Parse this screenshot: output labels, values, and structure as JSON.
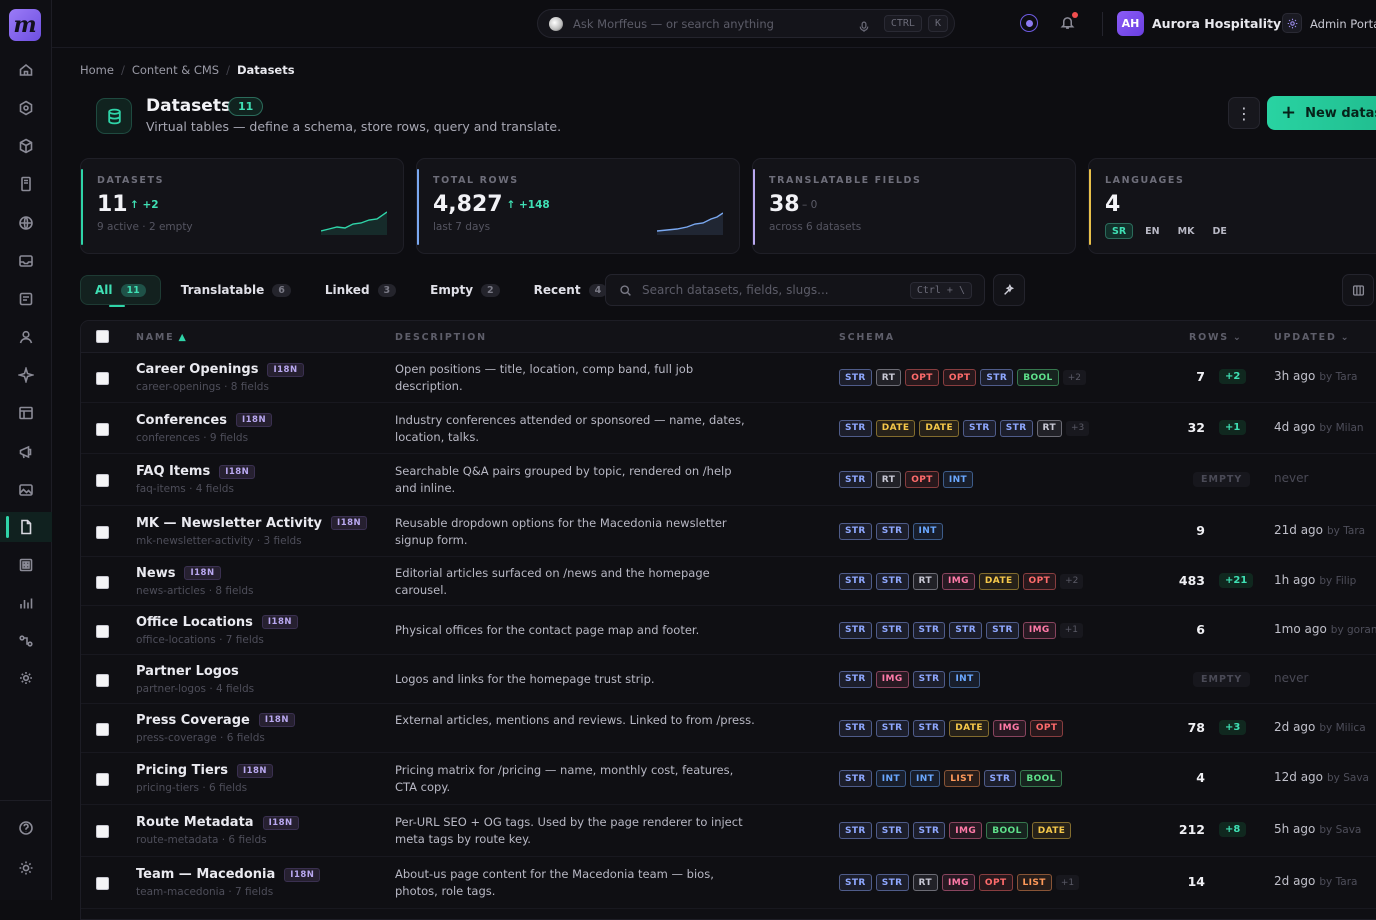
{
  "app": {
    "logo_letter": "m"
  },
  "sidebar": {
    "items": [
      "home-icon",
      "settings-hex-icon",
      "cube-icon",
      "book-icon",
      "globe-icon",
      "inbox-icon",
      "form-icon",
      "user-icon",
      "sparkle-icon",
      "table-icon",
      "megaphone-icon",
      "image-icon",
      "document-icon",
      "grid-icon",
      "bar-chart-icon",
      "flow-icon",
      "cog-icon"
    ],
    "active": "document-icon",
    "bottom": [
      "help-icon",
      "sun-icon"
    ]
  },
  "topbar": {
    "search_placeholder": "Ask Morffeus — or search anything",
    "kbd_ctrl": "CTRL",
    "kbd_k": "K",
    "avatar_initials": "AH",
    "org_name": "Aurora Hospitality",
    "portal_label": "Admin Portal"
  },
  "breadcrumb": {
    "items": [
      "Home",
      "Content & CMS"
    ],
    "current": "Datasets"
  },
  "header": {
    "title": "Datasets",
    "count": "11",
    "subtitle": "Virtual tables — define a schema, store rows, query and translate.",
    "new_button": "New dataset"
  },
  "stats": [
    {
      "label": "DATASETS",
      "value": "11",
      "delta": "+2",
      "sub": "9 active · 2 empty",
      "color": "#2fd4a8"
    },
    {
      "label": "TOTAL ROWS",
      "value": "4,827",
      "delta": "+148",
      "sub": "last 7 days",
      "color": "#7aa8f0"
    },
    {
      "label": "TRANSLATABLE FIELDS",
      "value": "38",
      "delta": "0",
      "sub": "across 6 datasets",
      "color": "#b9a8f0"
    },
    {
      "label": "LANGUAGES",
      "value": "4",
      "langs": [
        "SR",
        "EN",
        "MK",
        "DE"
      ],
      "color": "#e8c04a"
    }
  ],
  "filters": {
    "tabs": [
      {
        "label": "All",
        "count": "11"
      },
      {
        "label": "Translatable",
        "count": "6"
      },
      {
        "label": "Linked",
        "count": "3"
      },
      {
        "label": "Empty",
        "count": "2"
      },
      {
        "label": "Recent",
        "count": "4"
      }
    ],
    "active": "All",
    "search_placeholder": "Search datasets, fields, slugs...",
    "search_kbd": "Ctrl + \\"
  },
  "table": {
    "columns": {
      "name": "NAME",
      "description": "DESCRIPTION",
      "schema": "SCHEMA",
      "rows": "ROWS",
      "updated": "UPDATED"
    },
    "i18n_label": "I18N",
    "empty_label": "EMPTY",
    "chip_colors": {
      "STR": "#8fa8ff",
      "RT": "#c8c8d4",
      "OPT": "#ff6b6b",
      "BOOL": "#5ee08a",
      "DATE": "#f5c84a",
      "INT": "#6aa8ff",
      "IMG": "#ff7aa8",
      "LIST": "#ff9a5a"
    },
    "rows": [
      {
        "name": "Career Openings",
        "i18n": true,
        "slug": "career-openings · 8 fields",
        "desc": "Open positions — title, location, comp band, full job description.",
        "schema": [
          "STR",
          "RT",
          "OPT",
          "OPT",
          "STR",
          "BOOL"
        ],
        "more": "+2",
        "count": "7",
        "delta": "+2",
        "updated": "3h ago",
        "by": "by Tara"
      },
      {
        "name": "Conferences",
        "i18n": true,
        "slug": "conferences · 9 fields",
        "desc": "Industry conferences attended or sponsored — name, dates, location, talks.",
        "schema": [
          "STR",
          "DATE",
          "DATE",
          "STR",
          "STR",
          "RT"
        ],
        "more": "+3",
        "count": "32",
        "delta": "+1",
        "updated": "4d ago",
        "by": "by Milan"
      },
      {
        "name": "FAQ Items",
        "i18n": true,
        "slug": "faq-items · 4 fields",
        "desc": "Searchable Q&A pairs grouped by topic, rendered on /help and inline.",
        "schema": [
          "STR",
          "RT",
          "OPT",
          "INT"
        ],
        "more": "",
        "count": "",
        "delta": "",
        "empty": true,
        "updated": "never",
        "by": ""
      },
      {
        "name": "MK — Newsletter Activity",
        "i18n": true,
        "slug": "mk-newsletter-activity · 3 fields",
        "desc": "Reusable dropdown options for the Macedonia newsletter signup form.",
        "schema": [
          "STR",
          "STR",
          "INT"
        ],
        "more": "",
        "count": "9",
        "delta": "",
        "updated": "21d ago",
        "by": "by Tara"
      },
      {
        "name": "News",
        "i18n": true,
        "slug": "news-articles · 8 fields",
        "desc": "Editorial articles surfaced on /news and the homepage carousel.",
        "schema": [
          "STR",
          "STR",
          "RT",
          "IMG",
          "DATE",
          "OPT"
        ],
        "more": "+2",
        "count": "483",
        "delta": "+21",
        "updated": "1h ago",
        "by": "by Filip"
      },
      {
        "name": "Office Locations",
        "i18n": true,
        "slug": "office-locations · 7 fields",
        "desc": "Physical offices for the contact page map and footer.",
        "schema": [
          "STR",
          "STR",
          "STR",
          "STR",
          "STR",
          "IMG"
        ],
        "more": "+1",
        "count": "6",
        "delta": "",
        "updated": "1mo ago",
        "by": "by goran"
      },
      {
        "name": "Partner Logos",
        "i18n": false,
        "slug": "partner-logos · 4 fields",
        "desc": "Logos and links for the homepage trust strip.",
        "schema": [
          "STR",
          "IMG",
          "STR",
          "INT"
        ],
        "more": "",
        "count": "",
        "delta": "",
        "empty": true,
        "updated": "never",
        "by": ""
      },
      {
        "name": "Press Coverage",
        "i18n": true,
        "slug": "press-coverage · 6 fields",
        "desc": "External articles, mentions and reviews. Linked to from /press.",
        "schema": [
          "STR",
          "STR",
          "STR",
          "DATE",
          "IMG",
          "OPT"
        ],
        "more": "",
        "count": "78",
        "delta": "+3",
        "updated": "2d ago",
        "by": "by Milica"
      },
      {
        "name": "Pricing Tiers",
        "i18n": true,
        "slug": "pricing-tiers · 6 fields",
        "desc": "Pricing matrix for /pricing — name, monthly cost, features, CTA copy.",
        "schema": [
          "STR",
          "INT",
          "INT",
          "LIST",
          "STR",
          "BOOL"
        ],
        "more": "",
        "count": "4",
        "delta": "",
        "updated": "12d ago",
        "by": "by Sava"
      },
      {
        "name": "Route Metadata",
        "i18n": true,
        "slug": "route-metadata · 6 fields",
        "desc": "Per-URL SEO + OG tags. Used by the page renderer to inject meta tags by route key.",
        "schema": [
          "STR",
          "STR",
          "STR",
          "IMG",
          "BOOL",
          "DATE"
        ],
        "more": "",
        "count": "212",
        "delta": "+8",
        "updated": "5h ago",
        "by": "by Sava"
      },
      {
        "name": "Team — Macedonia",
        "i18n": true,
        "slug": "team-macedonia · 7 fields",
        "desc": "About-us page content for the Macedonia team — bios, photos, role tags.",
        "schema": [
          "STR",
          "STR",
          "RT",
          "IMG",
          "OPT",
          "LIST"
        ],
        "more": "+1",
        "count": "14",
        "delta": "",
        "updated": "2d ago",
        "by": "by Tara"
      }
    ]
  }
}
